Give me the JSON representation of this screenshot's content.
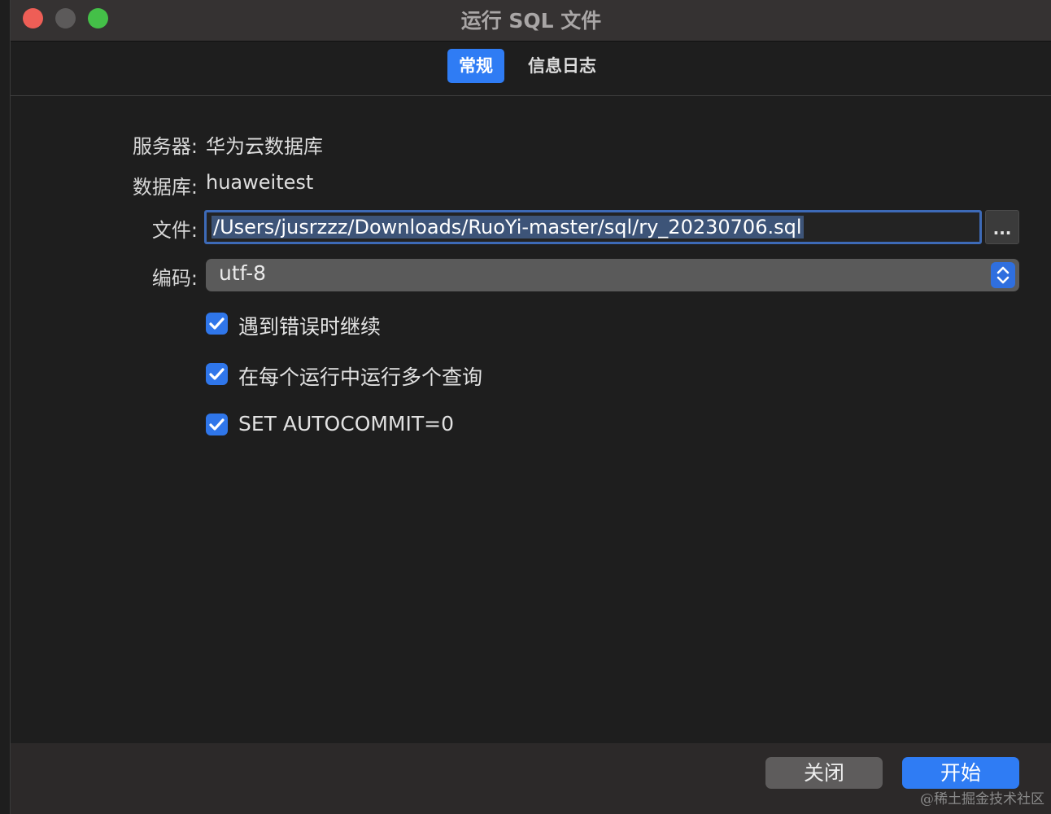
{
  "window": {
    "title": "运行 SQL 文件"
  },
  "tabs": [
    {
      "label": "常规",
      "active": true
    },
    {
      "label": "信息日志",
      "active": false
    }
  ],
  "form": {
    "server_label": "服务器:",
    "server_value": "华为云数据库",
    "database_label": "数据库:",
    "database_value": "huaweitest",
    "file_label": "文件:",
    "file_value": "/Users/jusrzzz/Downloads/RuoYi-master/sql/ry_20230706.sql",
    "browse_label": "...",
    "encoding_label": "编码:",
    "encoding_value": "utf-8"
  },
  "options": [
    {
      "label": "遇到错误时继续",
      "checked": true
    },
    {
      "label": "在每个运行中运行多个查询",
      "checked": true
    },
    {
      "label": "SET AUTOCOMMIT=0",
      "checked": true
    }
  ],
  "footer": {
    "close_label": "关闭",
    "start_label": "开始"
  },
  "watermark": "@稀土掘金技术社区",
  "colors": {
    "accent": "#2f7cf4",
    "close_light": "#ee5e56",
    "min_light": "#5c5a5a",
    "max_light": "#44c048"
  }
}
